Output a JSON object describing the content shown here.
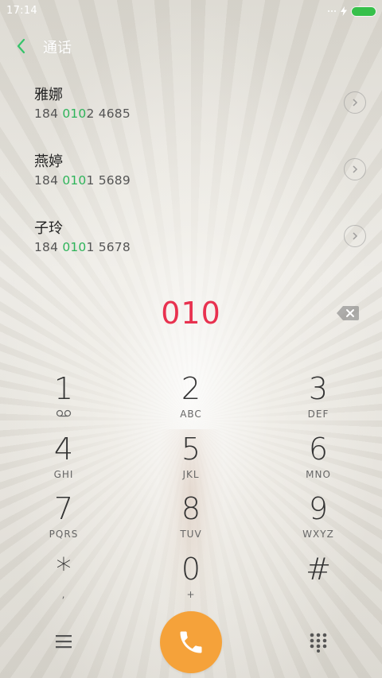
{
  "status_bar": {
    "time": "17:14",
    "battery_color": "#36c04a"
  },
  "header": {
    "title": "通话"
  },
  "contacts": [
    {
      "name": "雅娜",
      "number_prefix": "184 ",
      "number_match": "010",
      "number_suffix": "2 4685"
    },
    {
      "name": "燕婷",
      "number_prefix": "184 ",
      "number_match": "010",
      "number_suffix": "1 5689"
    },
    {
      "name": "子玲",
      "number_prefix": "184 ",
      "number_match": "010",
      "number_suffix": "1 5678"
    }
  ],
  "dialer": {
    "digits": "010",
    "digits_color": "#e8314f",
    "match_color": "#2eb45a"
  },
  "keypad": {
    "k1": {
      "digit": "1",
      "sub": "",
      "sub_icon": "voicemail-icon"
    },
    "k2": {
      "digit": "2",
      "sub": "ABC"
    },
    "k3": {
      "digit": "3",
      "sub": "DEF"
    },
    "k4": {
      "digit": "4",
      "sub": "GHI"
    },
    "k5": {
      "digit": "5",
      "sub": "JKL"
    },
    "k6": {
      "digit": "6",
      "sub": "MNO"
    },
    "k7": {
      "digit": "7",
      "sub": "PQRS"
    },
    "k8": {
      "digit": "8",
      "sub": "TUV"
    },
    "k9": {
      "digit": "9",
      "sub": "WXYZ"
    },
    "kstar": {
      "digit": "*",
      "sub": ","
    },
    "k0": {
      "digit": "0",
      "sub": "+"
    },
    "khash": {
      "digit": "#",
      "sub": ""
    }
  },
  "bottom_bar": {
    "call_button_color": "#f5a23a",
    "icons": [
      "menu-icon",
      "phone-icon",
      "dialpad-icon"
    ]
  }
}
